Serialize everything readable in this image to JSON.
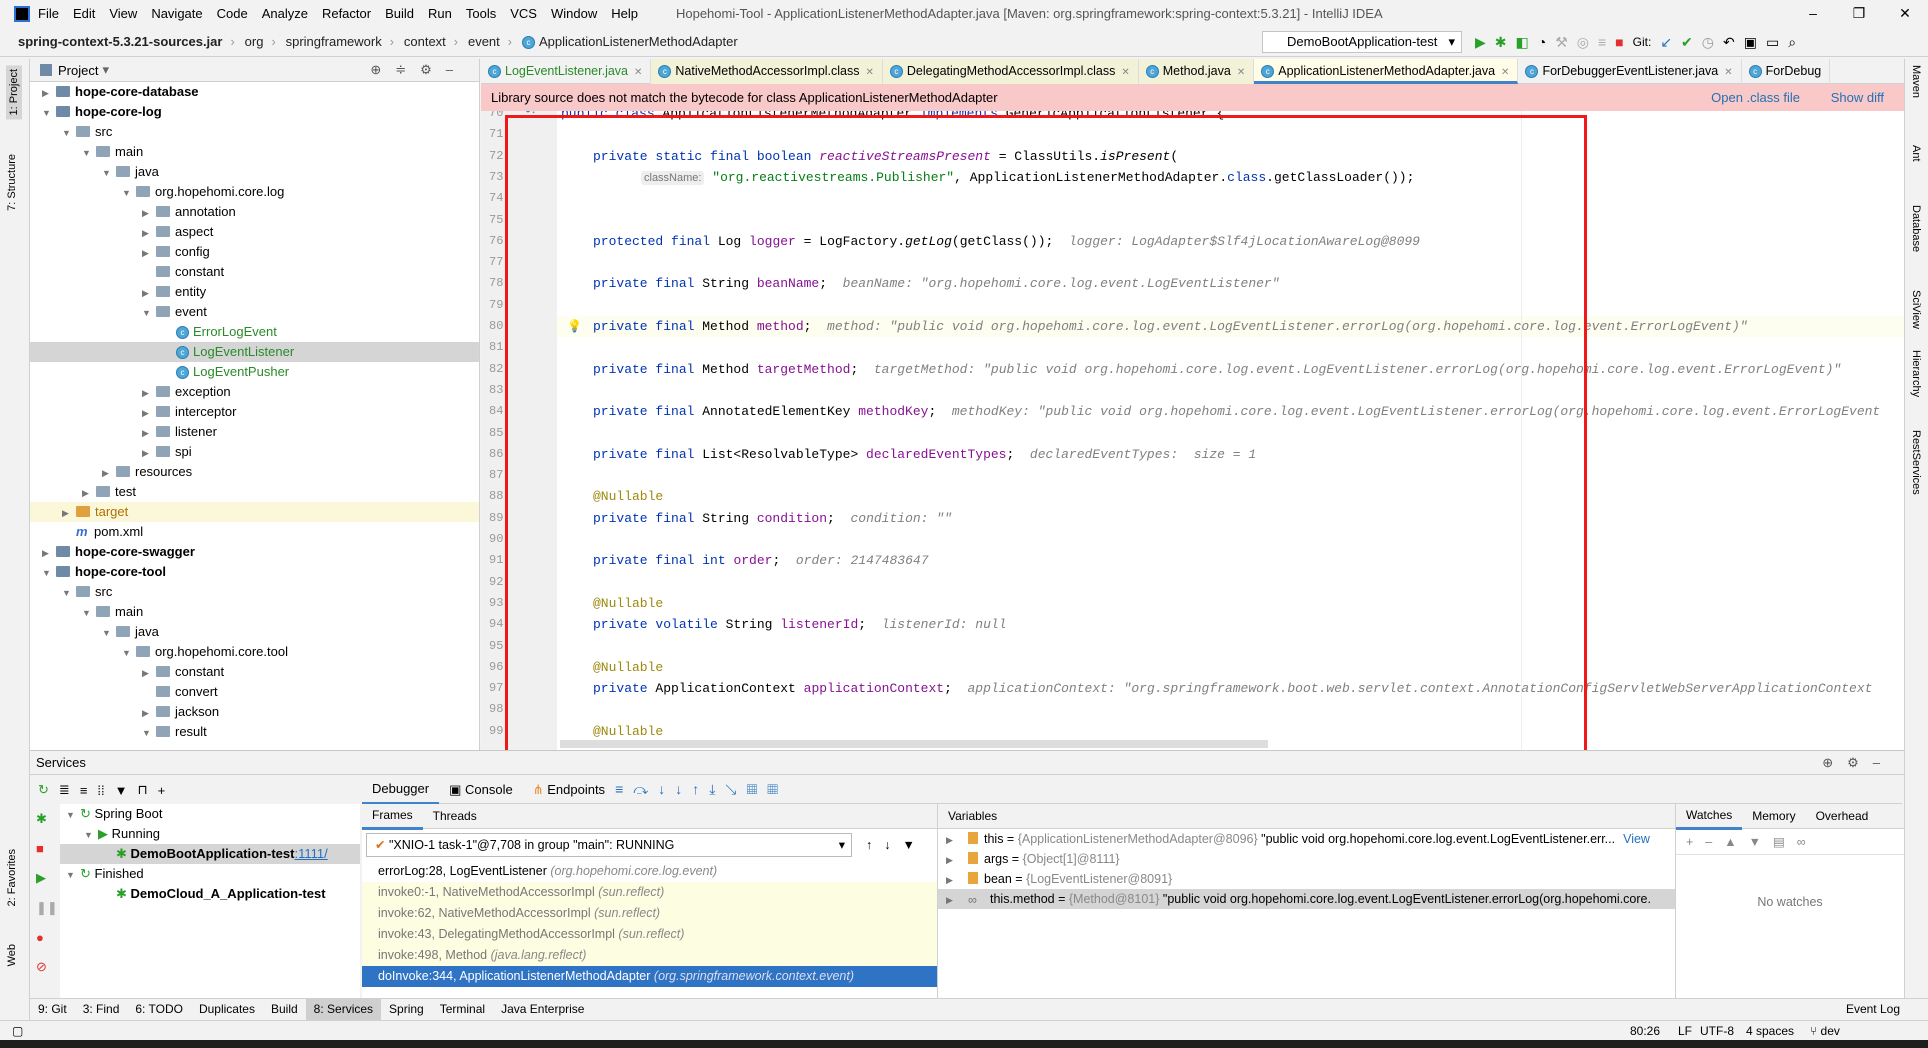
{
  "menu": {
    "items": [
      "File",
      "Edit",
      "View",
      "Navigate",
      "Code",
      "Analyze",
      "Refactor",
      "Build",
      "Run",
      "Tools",
      "VCS",
      "Window",
      "Help"
    ],
    "title": "Hopehomi-Tool - ApplicationListenerMethodAdapter.java [Maven: org.springframework:spring-context:5.3.21] - IntelliJ IDEA"
  },
  "breadcrumb": [
    "spring-context-5.3.21-sources.jar",
    "org",
    "springframework",
    "context",
    "event",
    "ApplicationListenerMethodAdapter"
  ],
  "run_config": "DemoBootApplication-test",
  "git_label": "Git:",
  "left_strip": [
    "1: Project",
    "7: Structure",
    "2: Favorites",
    "Web"
  ],
  "right_strip": [
    "Maven",
    "Ant",
    "Database",
    "SciView",
    "Hierarchy",
    "RestServices"
  ],
  "project": {
    "header": "Project",
    "tree": [
      {
        "d": 0,
        "l": "hope-core-database",
        "t": "mod",
        "o": false
      },
      {
        "d": 0,
        "l": "hope-core-log",
        "t": "mod",
        "o": true
      },
      {
        "d": 1,
        "l": "src",
        "t": "dir",
        "o": true
      },
      {
        "d": 2,
        "l": "main",
        "t": "dir",
        "o": true
      },
      {
        "d": 3,
        "l": "java",
        "t": "dir",
        "o": true
      },
      {
        "d": 4,
        "l": "org.hopehomi.core.log",
        "t": "dir",
        "o": true
      },
      {
        "d": 5,
        "l": "annotation",
        "t": "dir",
        "o": false
      },
      {
        "d": 5,
        "l": "aspect",
        "t": "dir",
        "o": false
      },
      {
        "d": 5,
        "l": "config",
        "t": "dir",
        "o": false
      },
      {
        "d": 5,
        "l": "constant",
        "t": "dir",
        "o": null
      },
      {
        "d": 5,
        "l": "entity",
        "t": "dir",
        "o": false
      },
      {
        "d": 5,
        "l": "event",
        "t": "dir",
        "o": true
      },
      {
        "d": 6,
        "l": "ErrorLogEvent",
        "t": "class",
        "o": null
      },
      {
        "d": 6,
        "l": "LogEventListener",
        "t": "class",
        "o": null,
        "sel": true
      },
      {
        "d": 6,
        "l": "LogEventPusher",
        "t": "class",
        "o": null
      },
      {
        "d": 5,
        "l": "exception",
        "t": "dir",
        "o": false
      },
      {
        "d": 5,
        "l": "interceptor",
        "t": "dir",
        "o": false
      },
      {
        "d": 5,
        "l": "listener",
        "t": "dir",
        "o": false
      },
      {
        "d": 5,
        "l": "spi",
        "t": "dir",
        "o": false
      },
      {
        "d": 3,
        "l": "resources",
        "t": "dir",
        "o": false
      },
      {
        "d": 2,
        "l": "test",
        "t": "dir",
        "o": false
      },
      {
        "d": 1,
        "l": "target",
        "t": "tgt",
        "o": false
      },
      {
        "d": 1,
        "l": "pom.xml",
        "t": "pom",
        "o": null
      },
      {
        "d": 0,
        "l": "hope-core-swagger",
        "t": "mod",
        "o": false
      },
      {
        "d": 0,
        "l": "hope-core-tool",
        "t": "mod",
        "o": true
      },
      {
        "d": 1,
        "l": "src",
        "t": "dir",
        "o": true
      },
      {
        "d": 2,
        "l": "main",
        "t": "dir",
        "o": true
      },
      {
        "d": 3,
        "l": "java",
        "t": "dir",
        "o": true
      },
      {
        "d": 4,
        "l": "org.hopehomi.core.tool",
        "t": "dir",
        "o": true
      },
      {
        "d": 5,
        "l": "constant",
        "t": "dir",
        "o": false
      },
      {
        "d": 5,
        "l": "convert",
        "t": "dir",
        "o": null
      },
      {
        "d": 5,
        "l": "jackson",
        "t": "dir",
        "o": false
      },
      {
        "d": 5,
        "l": "result",
        "t": "dir",
        "o": true
      }
    ]
  },
  "editor_tabs": [
    {
      "label": "LogEventListener.java",
      "kind": "src"
    },
    {
      "label": "NativeMethodAccessorImpl.class",
      "kind": "lib"
    },
    {
      "label": "DelegatingMethodAccessorImpl.class",
      "kind": "lib"
    },
    {
      "label": "Method.java",
      "kind": "lib"
    },
    {
      "label": "ApplicationListenerMethodAdapter.java",
      "kind": "active"
    },
    {
      "label": "ForDebuggerEventListener.java",
      "kind": "src"
    },
    {
      "label": "ForDebug",
      "kind": "src"
    }
  ],
  "banner": {
    "message": "Library source does not match the bytecode for class ApplicationListenerMethodAdapter",
    "open_class": "Open .class file",
    "show_diff": "Show diff"
  },
  "code": {
    "current_line": 80,
    "lines": [
      {
        "n": 70,
        "tk": [
          [
            "kw",
            "public class "
          ],
          [
            "",
            "ApplicationListenerMethodAdapter "
          ],
          [
            "kw",
            "implements "
          ],
          [
            "",
            "GenericApplicationListener {"
          ]
        ],
        "ind": 0
      },
      {
        "n": 71,
        "tk": []
      },
      {
        "n": 72,
        "tk": [
          [
            "kw",
            "private static final boolean "
          ],
          [
            "fld it",
            "reactiveStreamsPresent"
          ],
          [
            "",
            " = ClassUtils."
          ],
          [
            "it",
            "isPresent"
          ],
          [
            "",
            "("
          ]
        ]
      },
      {
        "n": 73,
        "tk": [
          [
            "inlay",
            "className:"
          ],
          [
            "str",
            " \"org.reactivestreams.Publisher\""
          ],
          [
            "",
            ", ApplicationListenerMethodAdapter."
          ],
          [
            "kw",
            "class"
          ],
          [
            "",
            ".getClassLoader());"
          ]
        ],
        "ind": 2
      },
      {
        "n": 74,
        "tk": []
      },
      {
        "n": 75,
        "tk": []
      },
      {
        "n": 76,
        "tk": [
          [
            "kw",
            "protected final "
          ],
          [
            "",
            "Log "
          ],
          [
            "fld",
            "logger"
          ],
          [
            "",
            " = LogFactory."
          ],
          [
            "it",
            "getLog"
          ],
          [
            "",
            "(getClass());"
          ],
          [
            "hint",
            "  logger: LogAdapter$Slf4jLocationAwareLog@8099"
          ]
        ]
      },
      {
        "n": 77,
        "tk": []
      },
      {
        "n": 78,
        "tk": [
          [
            "kw",
            "private final "
          ],
          [
            "",
            "String "
          ],
          [
            "fld",
            "beanName"
          ],
          [
            "",
            ";"
          ],
          [
            "hint",
            "  beanName: \"org.hopehomi.core.log.event.LogEventListener\""
          ]
        ]
      },
      {
        "n": 79,
        "tk": []
      },
      {
        "n": 80,
        "tk": [
          [
            "kw",
            "private final "
          ],
          [
            "",
            "Method "
          ],
          [
            "fld",
            "method"
          ],
          [
            "",
            ";"
          ],
          [
            "hint",
            "  method: \"public void org.hopehomi.core.log.event.LogEventListener.errorLog(org.hopehomi.core.log.event.ErrorLogEvent)\""
          ]
        ]
      },
      {
        "n": 81,
        "tk": []
      },
      {
        "n": 82,
        "tk": [
          [
            "kw",
            "private final "
          ],
          [
            "",
            "Method "
          ],
          [
            "fld",
            "targetMethod"
          ],
          [
            "",
            ";"
          ],
          [
            "hint",
            "  targetMethod: \"public void org.hopehomi.core.log.event.LogEventListener.errorLog(org.hopehomi.core.log.event.ErrorLogEvent)\""
          ]
        ]
      },
      {
        "n": 83,
        "tk": []
      },
      {
        "n": 84,
        "tk": [
          [
            "kw",
            "private final "
          ],
          [
            "",
            "AnnotatedElementKey "
          ],
          [
            "fld",
            "methodKey"
          ],
          [
            "",
            ";"
          ],
          [
            "hint",
            "  methodKey: \"public void org.hopehomi.core.log.event.LogEventListener.errorLog(org.hopehomi.core.log.event.ErrorLogEvent"
          ]
        ]
      },
      {
        "n": 85,
        "tk": []
      },
      {
        "n": 86,
        "tk": [
          [
            "kw",
            "private final "
          ],
          [
            "",
            "List<ResolvableType> "
          ],
          [
            "fld",
            "declaredEventTypes"
          ],
          [
            "",
            ";"
          ],
          [
            "hint",
            "  declaredEventTypes:  size = 1"
          ]
        ]
      },
      {
        "n": 87,
        "tk": []
      },
      {
        "n": 88,
        "tk": [
          [
            "ann",
            "@Nullable"
          ]
        ]
      },
      {
        "n": 89,
        "tk": [
          [
            "kw",
            "private final "
          ],
          [
            "",
            "String "
          ],
          [
            "fld",
            "condition"
          ],
          [
            "",
            ";"
          ],
          [
            "hint",
            "  condition: \"\""
          ]
        ]
      },
      {
        "n": 90,
        "tk": []
      },
      {
        "n": 91,
        "tk": [
          [
            "kw",
            "private final int "
          ],
          [
            "fld",
            "order"
          ],
          [
            "",
            ";"
          ],
          [
            "hint",
            "  order: 2147483647"
          ]
        ]
      },
      {
        "n": 92,
        "tk": []
      },
      {
        "n": 93,
        "tk": [
          [
            "ann",
            "@Nullable"
          ]
        ]
      },
      {
        "n": 94,
        "tk": [
          [
            "kw",
            "private volatile "
          ],
          [
            "",
            "String "
          ],
          [
            "fld",
            "listenerId"
          ],
          [
            "",
            ";"
          ],
          [
            "hint",
            "  listenerId: null"
          ]
        ]
      },
      {
        "n": 95,
        "tk": []
      },
      {
        "n": 96,
        "tk": [
          [
            "ann",
            "@Nullable"
          ]
        ]
      },
      {
        "n": 97,
        "tk": [
          [
            "kw",
            "private "
          ],
          [
            "",
            "ApplicationContext "
          ],
          [
            "fld",
            "applicationContext"
          ],
          [
            "",
            ";"
          ],
          [
            "hint",
            "  applicationContext: \"org.springframework.boot.web.servlet.context.AnnotationConfigServletWebServerApplicationContext"
          ]
        ]
      },
      {
        "n": 98,
        "tk": []
      },
      {
        "n": 99,
        "tk": [
          [
            "ann",
            "@Nullable"
          ]
        ]
      }
    ]
  },
  "services": {
    "title": "Services",
    "tree": [
      {
        "d": 0,
        "l": "Spring Boot",
        "b": false
      },
      {
        "d": 1,
        "l": "Running",
        "b": false
      },
      {
        "d": 2,
        "l": "DemoBootApplication-test",
        "b": true,
        "port": ":1111/",
        "sel": true
      },
      {
        "d": 0,
        "l": "Finished",
        "b": false
      },
      {
        "d": 2,
        "l": "DemoCloud_A_Application-test",
        "b": true
      }
    ]
  },
  "debugger": {
    "tabs": [
      "Debugger",
      "Console",
      "Endpoints"
    ],
    "frames_tabs": [
      "Frames",
      "Threads"
    ],
    "thread": "\"XNIO-1 task-1\"@7,708 in group \"main\": RUNNING",
    "frames": [
      {
        "m": "errorLog:28, LogEventListener",
        "p": "(org.hopehomi.core.log.event)",
        "k": "src"
      },
      {
        "m": "invoke0:-1, NativeMethodAccessorImpl",
        "p": "(sun.reflect)",
        "k": "lib"
      },
      {
        "m": "invoke:62, NativeMethodAccessorImpl",
        "p": "(sun.reflect)",
        "k": "lib"
      },
      {
        "m": "invoke:43, DelegatingMethodAccessorImpl",
        "p": "(sun.reflect)",
        "k": "lib"
      },
      {
        "m": "invoke:498, Method",
        "p": "(java.lang.reflect)",
        "k": "lib"
      },
      {
        "m": "doInvoke:344, ApplicationListenerMethodAdapter",
        "p": "(org.springframework.context.event)",
        "k": "sel"
      }
    ],
    "variables_title": "Variables",
    "variables": [
      {
        "n": "this",
        "g": "{ApplicationListenerMethodAdapter@8096}",
        "v": " \"public void org.hopehomi.core.log.event.LogEventListener.err...",
        "link": "View"
      },
      {
        "n": "args",
        "g": "{Object[1]@8111}",
        "v": ""
      },
      {
        "n": "bean",
        "g": "{LogEventListener@8091}",
        "v": ""
      },
      {
        "n": "this.method",
        "g": "{Method@8101}",
        "v": " \"public void org.hopehomi.core.log.event.LogEventListener.errorLog(org.hopehomi.core.",
        "sel": true
      }
    ],
    "watch_tabs": [
      "Watches",
      "Memory",
      "Overhead"
    ],
    "no_watches": "No watches"
  },
  "bottom_tabs": [
    "9: Git",
    "3: Find",
    "6: TODO",
    "Duplicates",
    "Build",
    "8: Services",
    "Spring",
    "Terminal",
    "Java Enterprise"
  ],
  "active_bottom_tab": "8: Services",
  "event_log": "Event Log",
  "status": {
    "position": "80:26",
    "line_sep": "LF",
    "encoding": "UTF-8",
    "indent": "4 spaces",
    "branch": "dev"
  }
}
